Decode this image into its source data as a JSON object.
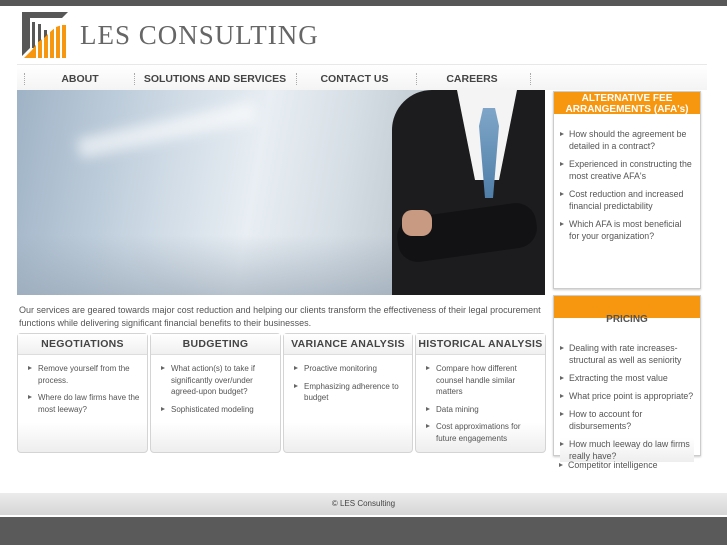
{
  "brand": {
    "name": "LES CONSULTING",
    "logo_colors": {
      "grey": "#555555",
      "orange": "#f7960f"
    }
  },
  "nav": [
    {
      "label": "ABOUT"
    },
    {
      "label": "SOLUTIONS AND SERVICES"
    },
    {
      "label": "CONTACT US"
    },
    {
      "label": "CAREERS"
    }
  ],
  "intro": "Our services are geared towards major cost reduction and helping our clients transform the effectiveness of their legal procurement functions while delivering significant financial benefits to their businesses.",
  "cards": [
    {
      "title": "NEGOTIATIONS",
      "items": [
        "Remove yourself from the process.",
        "Where do law firms have the most leeway?"
      ]
    },
    {
      "title": "BUDGETING",
      "items": [
        "What action(s) to take if significantly over/under agreed-upon budget?",
        "Sophisticated modeling"
      ]
    },
    {
      "title": "VARIANCE ANALYSIS",
      "items": [
        "Proactive monitoring",
        "Emphasizing adherence to budget"
      ]
    },
    {
      "title": "HISTORICAL ANALYSIS",
      "items": [
        "Compare how different counsel handle similar matters",
        "Data mining",
        "Cost approximations for future engagements"
      ]
    }
  ],
  "afa": {
    "title": "ALTERNATIVE FEE ARRANGEMENTS (AFA's)",
    "items": [
      "How should the agreement be detailed in a contract?",
      "Experienced in constructing the most creative AFA's",
      "Cost reduction and increased financial predictability",
      "Which AFA is most beneficial for your organization?"
    ]
  },
  "pricing": {
    "title": "PRICING",
    "items": [
      "Dealing with rate increases- structural as well as seniority",
      "Extracting the most value",
      "What price point is appropriate?",
      "How to account for disbursements?",
      "How much leeway do law firms really have?"
    ],
    "extra": "Competitor intelligence"
  },
  "footer": "© LES Consulting",
  "colors": {
    "accent": "#f7960f"
  }
}
